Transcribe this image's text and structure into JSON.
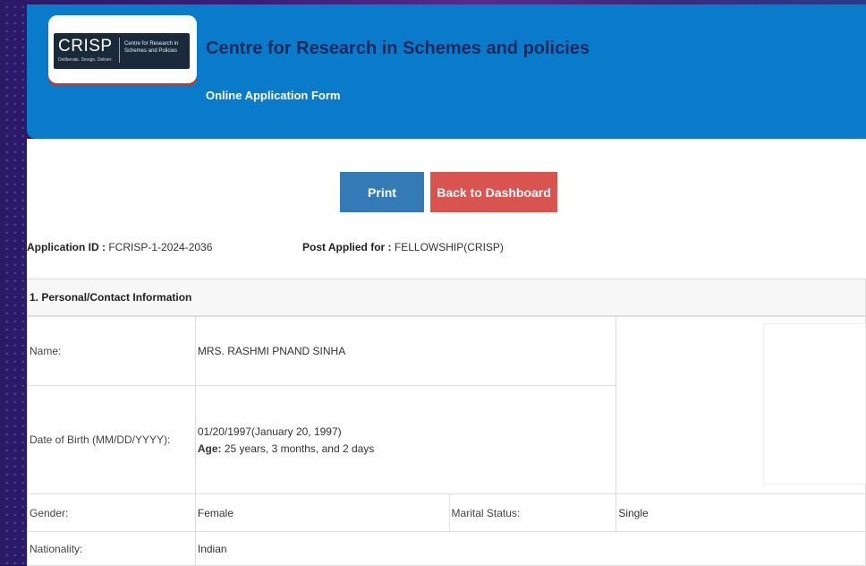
{
  "header": {
    "logo": {
      "main": "CRISP",
      "tagline": "Deliberate. Design. Deliver.",
      "side_line1": "Centre for Research in",
      "side_line2": "Schemes and Policies"
    },
    "title": "Centre for Research in Schemes and policies",
    "subtitle": "Online Application Form"
  },
  "actions": {
    "print_label": "Print",
    "back_label": "Back to Dashboard"
  },
  "application": {
    "id_label": "Application ID :",
    "id_value": "FCRISP-1-2024-2036",
    "post_label": "Post Applied for :",
    "post_value": "FELLOWSHIP(CRISP)"
  },
  "section": {
    "title": "1. Personal/Contact Information"
  },
  "personal": {
    "name_label": "Name:",
    "name_value": "MRS. RASHMI PNAND SINHA",
    "dob_label": "Date of Birth (MM/DD/YYYY):",
    "dob_value": "01/20/1997(January 20, 1997)",
    "age_label": "Age:",
    "age_value": "25 years, 3 months, and 2 days",
    "gender_label": "Gender:",
    "gender_value": "Female",
    "marital_label": "Marital Status:",
    "marital_value": "Single",
    "nationality_label": "Nationality:",
    "nationality_value": "Indian"
  },
  "colors": {
    "header_bg": "#0a7acb",
    "title_color": "#1b2a5c",
    "print_btn": "#337ab7",
    "back_btn": "#d9534f"
  }
}
